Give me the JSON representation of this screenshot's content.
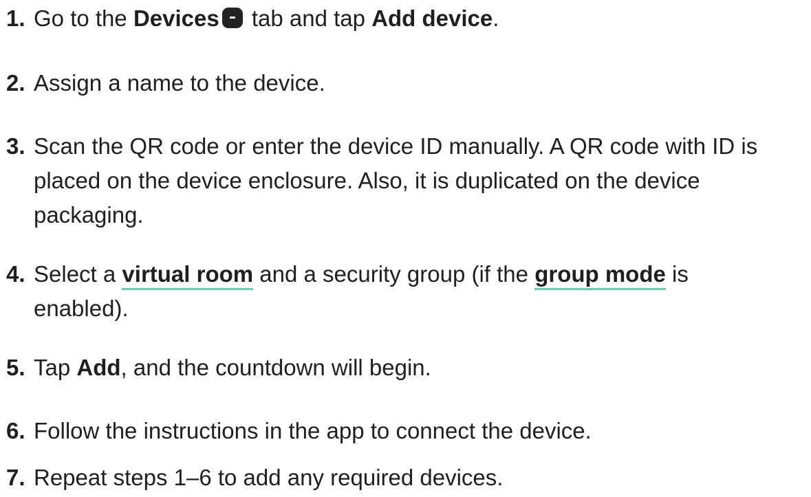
{
  "steps": [
    {
      "number": "1.",
      "t1": "Go to the ",
      "b1": "Devices",
      "icon": "devices-tab-icon",
      "t2": " tab and tap ",
      "b2": "Add device",
      "t3": "."
    },
    {
      "number": "2.",
      "text": "Assign a name to the device."
    },
    {
      "number": "3.",
      "line1": "Scan the QR code or enter the device ID manually. A QR code with ID is",
      "line2": "placed on the device enclosure. Also, it is duplicated on the device",
      "line3": "packaging."
    },
    {
      "number": "4.",
      "t1": "Select a ",
      "link1": "virtual room",
      "t2": " and a security group (if the ",
      "link2": "group mode",
      "t3": " is",
      "line2": "enabled)."
    },
    {
      "number": "5.",
      "t1": "Tap ",
      "b1": "Add",
      "t2": ", and the countdown will begin."
    },
    {
      "number": "6.",
      "text": "Follow the instructions in the app to connect the device."
    },
    {
      "number": "7.",
      "text": "Repeat steps 1–6 to add any required devices."
    }
  ],
  "colors": {
    "text": "#1f1f1f",
    "link_underline": "#5fd6a6",
    "icon_bg": "#222222"
  }
}
